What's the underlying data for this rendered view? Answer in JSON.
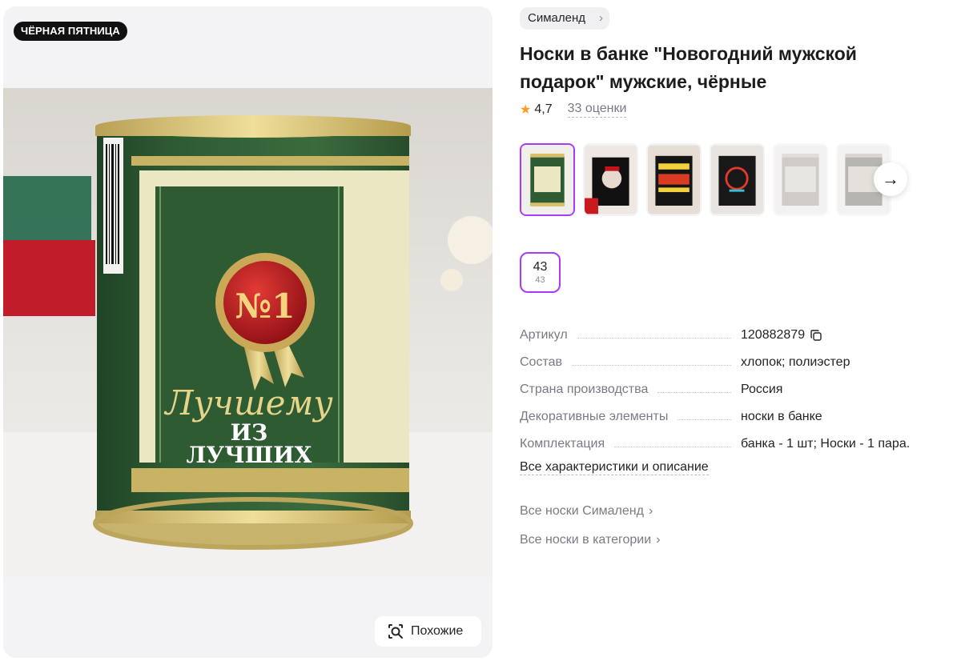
{
  "product": {
    "badge": "ЧЁРНАЯ ПЯТНИЦА",
    "brand": "Сималенд",
    "title": "Носки в банке \"Новогодний мужской подарок\" мужские, чёрные",
    "rating": "4,7",
    "reviews": "33 оценки",
    "similar_label": "Похожие",
    "photo_texts": {
      "seal": "№1",
      "line1": "Лучшему",
      "line2": "ИЗ",
      "line3": "ЛУЧШИХ"
    }
  },
  "size": {
    "main": "43",
    "sub": "43"
  },
  "specs": [
    {
      "key": "Артикул",
      "value": "120882879"
    },
    {
      "key": "Состав",
      "value": "хлопок; полиэстер"
    },
    {
      "key": "Страна производства",
      "value": "Россия"
    },
    {
      "key": "Декоративные элементы",
      "value": "носки в банке"
    },
    {
      "key": "Комплектация",
      "value": "банка - 1 шт; Носки - 1 пара."
    }
  ],
  "all_specs_link": "Все характеристики и описание",
  "links": {
    "brand_socks": "Все носки Сималенд",
    "category_socks": "Все носки в категории"
  },
  "icons": {
    "star": "star-icon",
    "copy": "copy-icon",
    "next": "arrow-right-icon",
    "similar": "search-similar-icon",
    "chevron": "chevron-right-icon"
  },
  "colors": {
    "accent": "#a73afd",
    "star": "#ff9a1f",
    "can_green": "#2f5b33",
    "seal_red": "#b8141c",
    "gold": "#d8c06a"
  }
}
